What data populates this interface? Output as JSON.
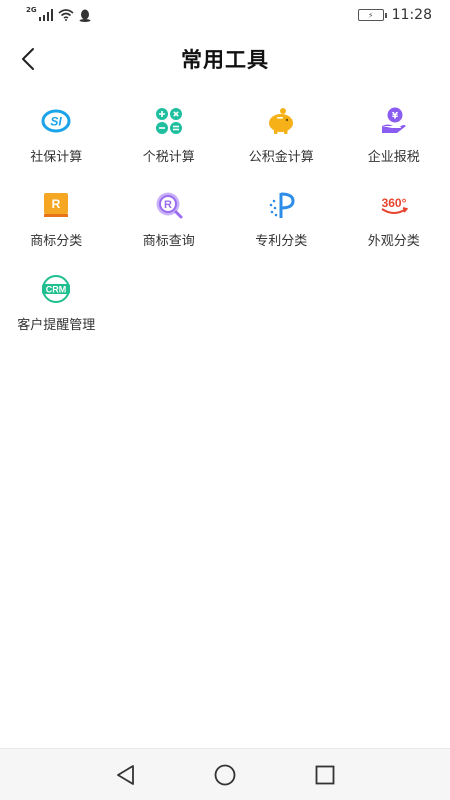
{
  "status_bar": {
    "network_type": "2G",
    "time": "11:28",
    "icons": [
      "signal-icon",
      "wifi-icon",
      "qq-icon",
      "battery-icon"
    ]
  },
  "header": {
    "title": "常用工具",
    "back_icon": "back-arrow-icon"
  },
  "tools": [
    {
      "label": "社保计算",
      "icon": "social-security-icon",
      "color": "#1aa3e8"
    },
    {
      "label": "个税计算",
      "icon": "tax-calculator-icon",
      "color": "#1fbf9f"
    },
    {
      "label": "公积金计算",
      "icon": "piggy-bank-icon",
      "color": "#f5b117"
    },
    {
      "label": "企业报税",
      "icon": "hand-coin-icon",
      "color": "#8a5cf0"
    },
    {
      "label": "商标分类",
      "icon": "trademark-book-icon",
      "color": "#f5a623"
    },
    {
      "label": "商标查询",
      "icon": "trademark-search-icon",
      "color": "#9b6cf0"
    },
    {
      "label": "专利分类",
      "icon": "patent-icon",
      "color": "#2e8de8"
    },
    {
      "label": "外观分类",
      "icon": "360-view-icon",
      "color": "#e8452e"
    },
    {
      "label": "客户提醒管理",
      "icon": "crm-icon",
      "color": "#1fbf8f"
    }
  ],
  "nav_bar": {
    "icons": [
      "back-triangle-icon",
      "home-circle-icon",
      "recents-square-icon"
    ]
  }
}
